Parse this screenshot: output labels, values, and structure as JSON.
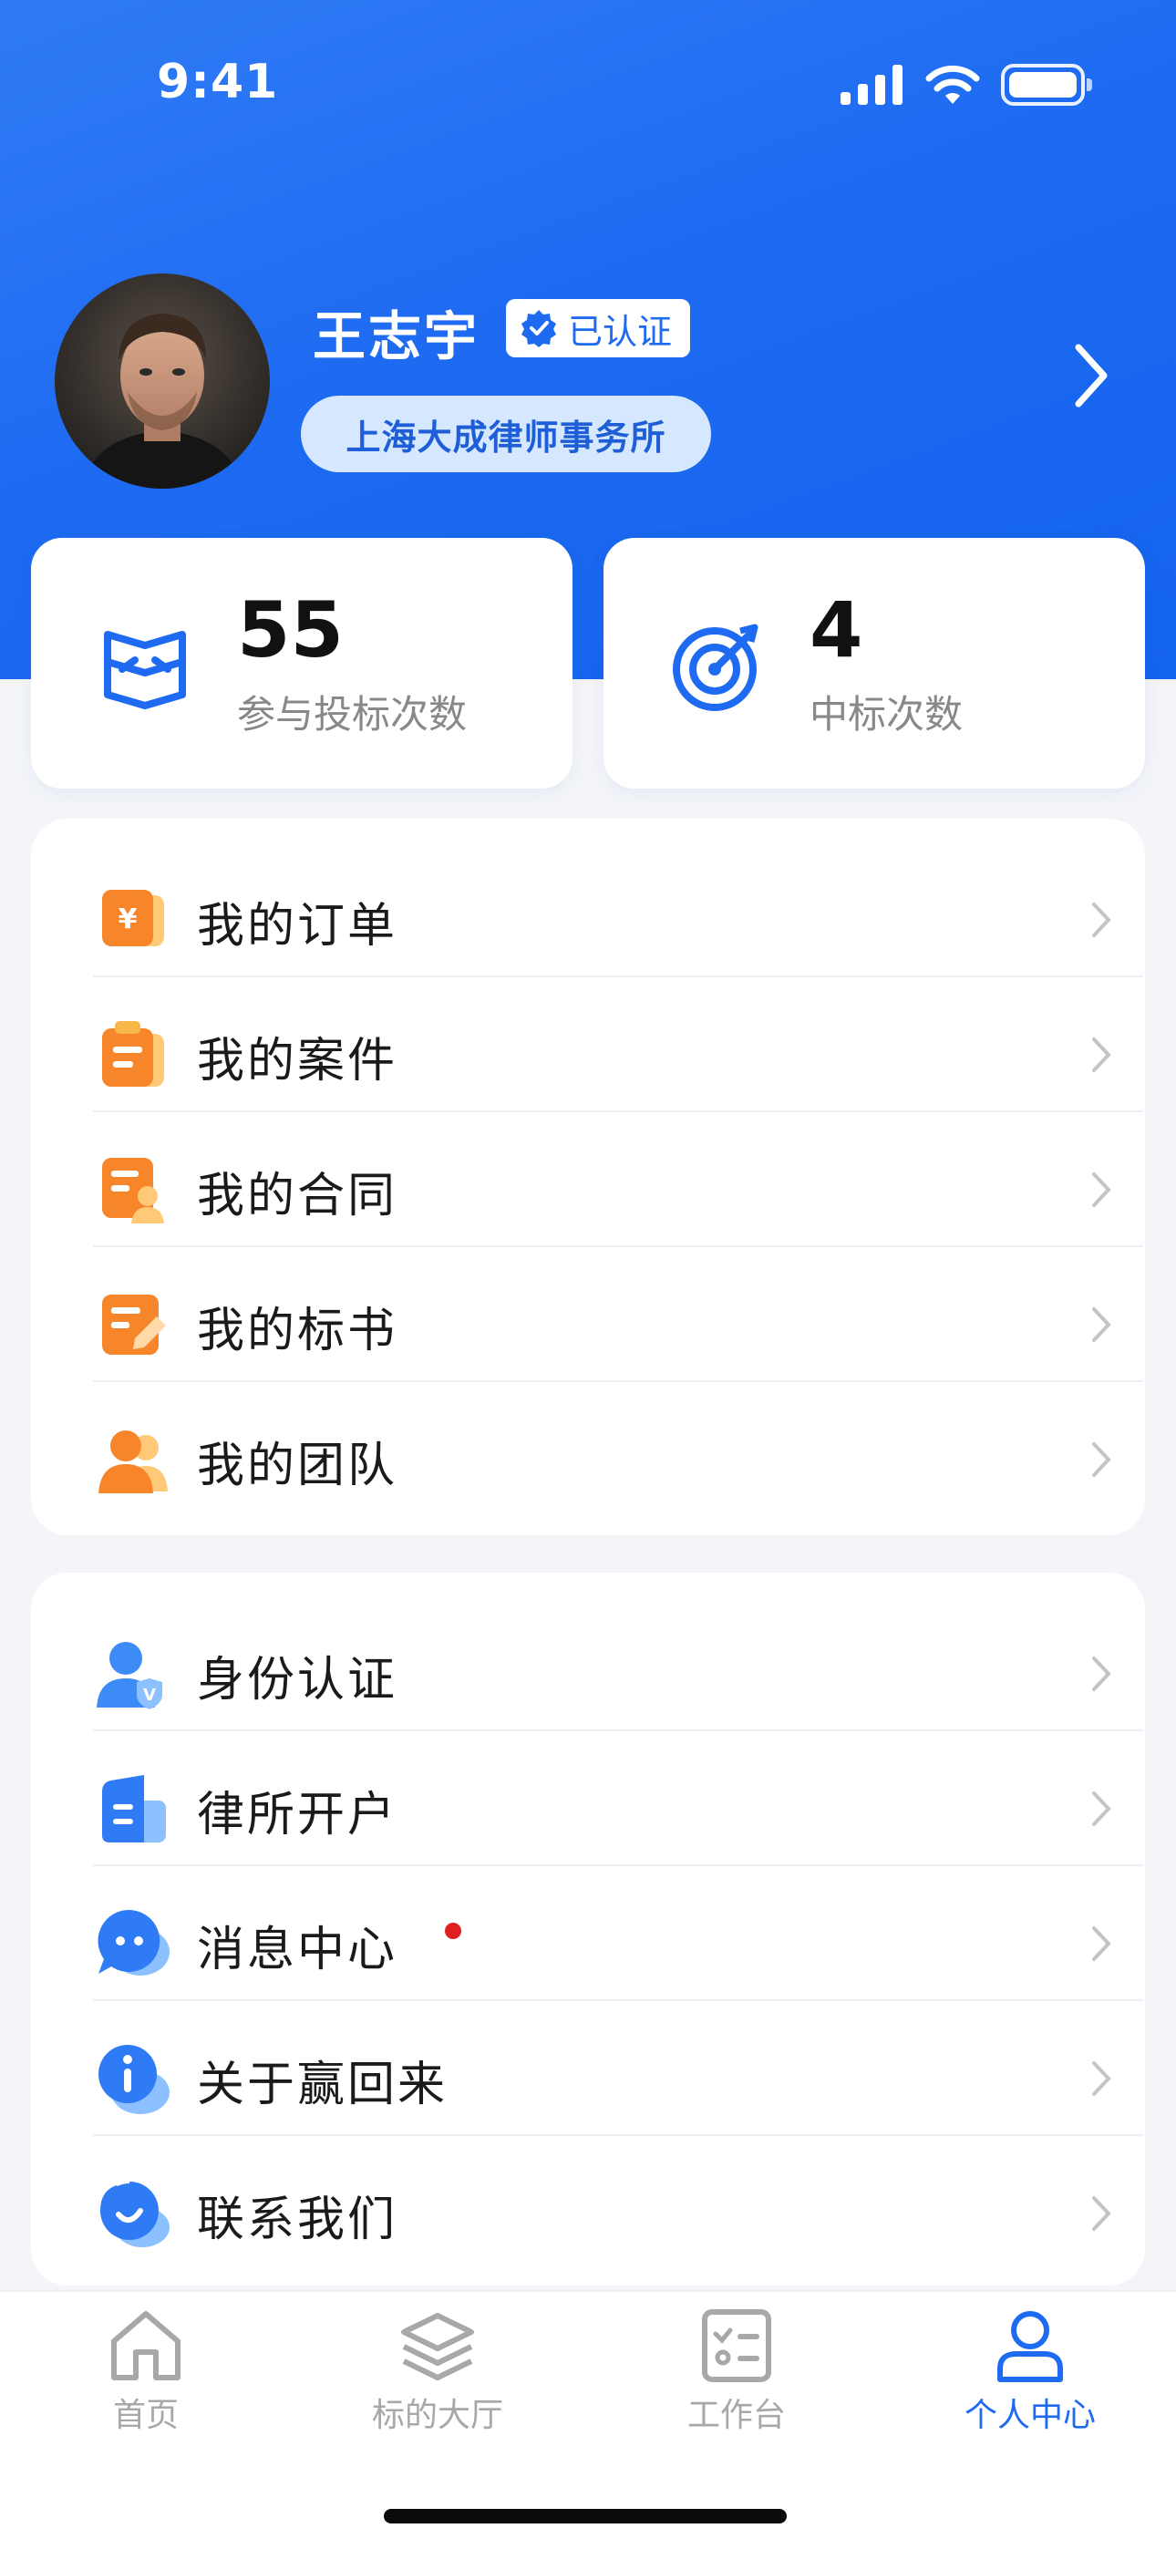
{
  "status_bar": {
    "time": "9:41"
  },
  "profile": {
    "name": "王志宇",
    "verified_label": "已认证",
    "firm": "上海大成律师事务所"
  },
  "stats": [
    {
      "value": "55",
      "label": "参与投标次数",
      "icon": "bid-icon"
    },
    {
      "value": "4",
      "label": "中标次数",
      "icon": "target-icon"
    }
  ],
  "menu_primary": [
    {
      "label": "我的订单",
      "icon": "order-icon"
    },
    {
      "label": "我的案件",
      "icon": "case-icon"
    },
    {
      "label": "我的合同",
      "icon": "contract-icon"
    },
    {
      "label": "我的标书",
      "icon": "tender-icon"
    },
    {
      "label": "我的团队",
      "icon": "team-icon"
    }
  ],
  "menu_secondary": [
    {
      "label": "身份认证",
      "icon": "identity-icon"
    },
    {
      "label": "律所开户",
      "icon": "building-icon"
    },
    {
      "label": "消息中心",
      "icon": "message-icon",
      "unread": true
    },
    {
      "label": "关于赢回来",
      "icon": "info-icon"
    },
    {
      "label": "联系我们",
      "icon": "contact-icon"
    }
  ],
  "tabbar": [
    {
      "label": "首页",
      "icon": "home-icon",
      "active": false
    },
    {
      "label": "标的大厅",
      "icon": "layers-icon",
      "active": false
    },
    {
      "label": "工作台",
      "icon": "checklist-icon",
      "active": false
    },
    {
      "label": "个人中心",
      "icon": "person-icon",
      "active": true
    }
  ],
  "colors": {
    "primary": "#1E6BF2",
    "orange": "#F7862A",
    "badge_red": "#E02020",
    "inactive_tab": "#A8A8A8"
  }
}
